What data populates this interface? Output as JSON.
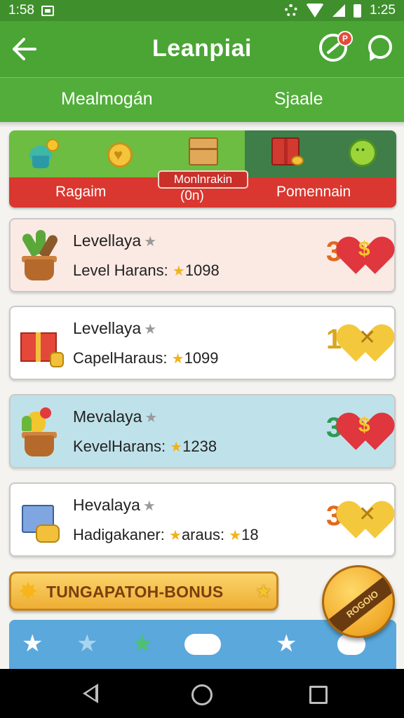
{
  "status_bar": {
    "time_left": "1:58",
    "time_right": "1:25",
    "icons": [
      "image-icon",
      "gear-icon",
      "wifi-icon",
      "signal-icon",
      "battery-icon"
    ]
  },
  "app_bar": {
    "title": "Leanpiai",
    "badge": "P",
    "icons": [
      "back-arrow-icon",
      "compass-icon",
      "chat-icon"
    ]
  },
  "tabs": [
    {
      "label": "Mealmogán"
    },
    {
      "label": "Sjaale"
    }
  ],
  "categories": {
    "left_label": "Ragaim",
    "center_label": "Monlnrakin",
    "center_sub": "(0n)",
    "right_label": "Pomennain",
    "icons": [
      "cupcake-icon",
      "heart-coin-icon",
      "crate-icon",
      "gift-icon",
      "ball-icon"
    ]
  },
  "rows": [
    {
      "name": "Levellaya",
      "detail_prefix": "Level Harans:",
      "detail_value": "1098",
      "count": "3",
      "badge_symbol": "$",
      "badge_type": "red-heart",
      "bg": "#fbe9e4"
    },
    {
      "name": "Levellaya",
      "detail_prefix": "CapelHaraus:",
      "detail_value": "1099",
      "count": "1",
      "badge_symbol": "✕",
      "badge_type": "gold-heart",
      "bg": "#ffffff"
    },
    {
      "name": "Mevalaya",
      "detail_prefix": "KevelHarans:",
      "detail_value": "1238",
      "count": "3",
      "badge_symbol": "$",
      "badge_type": "red-heart",
      "bg": "#bfe2ea"
    },
    {
      "name": "Hevalaya",
      "detail_prefix": "Hadigakaner:",
      "detail_mid": "araus:",
      "detail_value": "18",
      "count": "3",
      "badge_symbol": "✕",
      "badge_type": "gold-heart",
      "bg": "#ffffff"
    }
  ],
  "bonus": {
    "label": "TUNGAPATOH-BONUS"
  },
  "fab": {
    "label": "ROGOIO"
  },
  "colors": {
    "primary_green": "#4aa535",
    "red": "#d9372f",
    "gold": "#f3c83d",
    "sky": "#5aa8dc"
  }
}
